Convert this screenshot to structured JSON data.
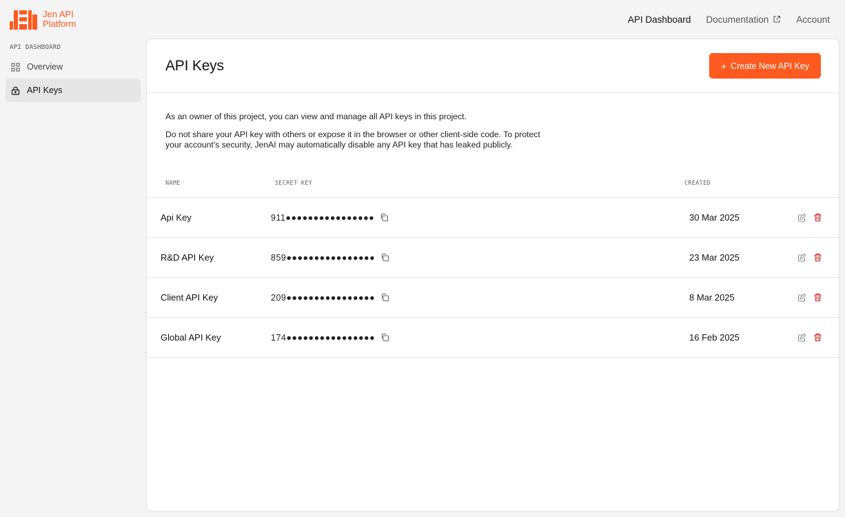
{
  "brand": {
    "line1": "Jen API",
    "line2": "Platform",
    "accent": "#ff5a1f"
  },
  "topnav": {
    "dashboard": "API Dashboard",
    "documentation": "Documentation",
    "account": "Account"
  },
  "sidebar": {
    "section_title": "API DASHBOARD",
    "items": [
      {
        "label": "Overview",
        "icon": "grid-icon"
      },
      {
        "label": "API Keys",
        "icon": "lock-icon"
      }
    ]
  },
  "main": {
    "title": "API Keys",
    "create_button": "Create New API Key",
    "description_1": "As an owner of this project, you can view and manage all API keys in this project.",
    "description_2": "Do not share your API key with others or expose it in the browser or other client-side code. To protect your account's security, JenAI may automatically disable any API key that has leaked publicly.",
    "table": {
      "columns": {
        "name": "NAME",
        "secret": "SECRET KEY",
        "created": "CREATED"
      },
      "rows": [
        {
          "name": "Api Key",
          "secret": "911●●●●●●●●●●●●●●●●",
          "created": "30 Mar 2025"
        },
        {
          "name": "R&D API Key",
          "secret": "859●●●●●●●●●●●●●●●●",
          "created": "23 Mar 2025"
        },
        {
          "name": "Client API Key",
          "secret": "209●●●●●●●●●●●●●●●●",
          "created": "8 Mar 2025"
        },
        {
          "name": "Global API Key",
          "secret": "174●●●●●●●●●●●●●●●●",
          "created": "16 Feb 2025"
        }
      ]
    }
  },
  "colors": {
    "accent": "#ff5a1f",
    "danger": "#d0312d"
  }
}
